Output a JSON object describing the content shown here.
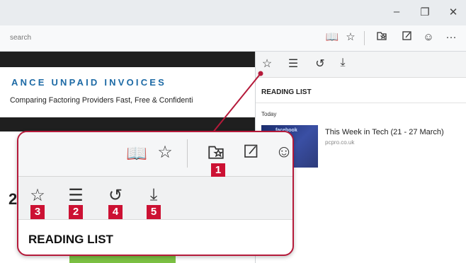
{
  "browser": {
    "address_text": "search",
    "window_controls": {
      "minimize": "–",
      "maximize": "❐",
      "close": "✕"
    },
    "toolbar_icons": [
      "reading-view-icon",
      "favorite-star-icon",
      "hub-icon",
      "web-note-icon",
      "feedback-smiley-icon",
      "more-icon"
    ]
  },
  "webpage": {
    "headline": "ANCE UNPAID INVOICES",
    "tagline": "Comparing Factoring Providers Fast, Free & Confidenti",
    "partial_number": "2"
  },
  "hub": {
    "tabs": [
      "favorites",
      "reading-list",
      "history",
      "downloads"
    ],
    "title": "READING LIST",
    "section": "Today",
    "item": {
      "title": "This Week in Tech (21 - 27 March)",
      "source": "pcpro.co.uk",
      "thumb_text": "facebook"
    }
  },
  "zoom": {
    "badges": {
      "hub": "1",
      "reading_list": "2",
      "favorites": "3",
      "history": "4",
      "downloads": "5"
    },
    "title": "READING LIST"
  },
  "colors": {
    "accent": "#cc1133",
    "headline": "#1d6aa5",
    "green": "#7bc043"
  }
}
